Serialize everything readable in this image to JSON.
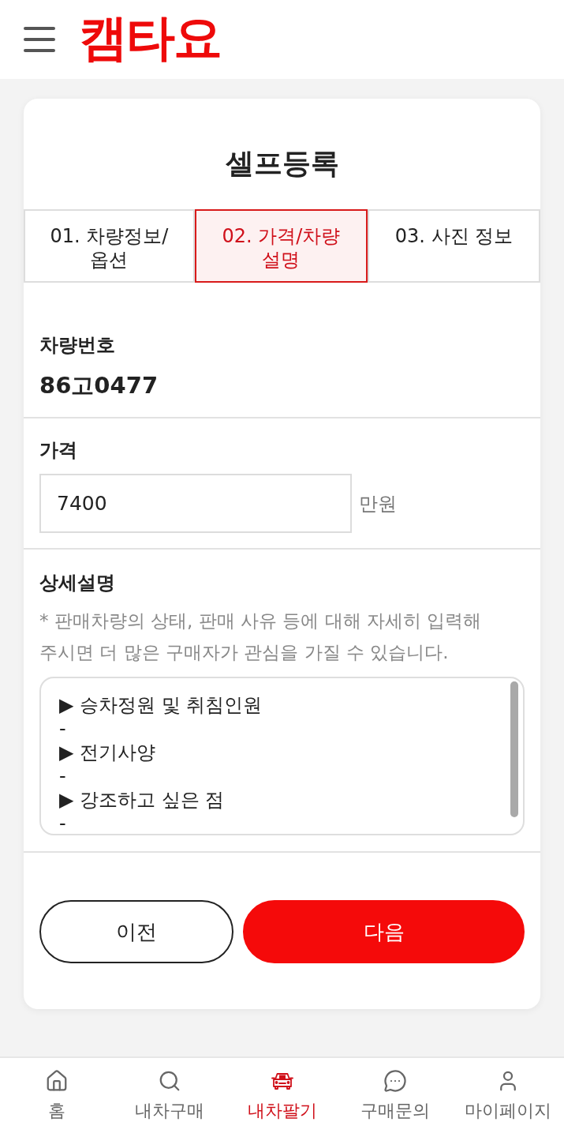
{
  "header": {
    "logo": "캠타요"
  },
  "page_title": "셀프등록",
  "steps": [
    {
      "label": "01. 차량정보/\n옵션",
      "selected": false
    },
    {
      "label": "02. 가격/차량\n설명",
      "selected": true
    },
    {
      "label": "03. 사진 정보",
      "selected": false
    }
  ],
  "vehicle_number": {
    "label": "차량번호",
    "value": "86고0477"
  },
  "price": {
    "label": "가격",
    "value": "7400",
    "unit": "만원"
  },
  "description": {
    "label": "상세설명",
    "hint": "* 판매차량의 상태, 판매 사유 등에 대해 자세히 입력해 주시면 더 많은 구매자가 관심을 가질 수 있습니다.",
    "value": "▶ 승차정원 및 취침인원\n-\n▶ 전기사양\n-\n▶ 강조하고 싶은 점\n-"
  },
  "buttons": [
    {
      "label": "이전",
      "kind": "secondary"
    },
    {
      "label": "다음",
      "kind": "primary"
    }
  ],
  "bottom_nav": [
    {
      "label": "홈",
      "selected": false
    },
    {
      "label": "내차구매",
      "selected": false
    },
    {
      "label": "내차팔기",
      "selected": true
    },
    {
      "label": "구매문의",
      "selected": false
    },
    {
      "label": "마이페이지",
      "selected": false
    }
  ]
}
